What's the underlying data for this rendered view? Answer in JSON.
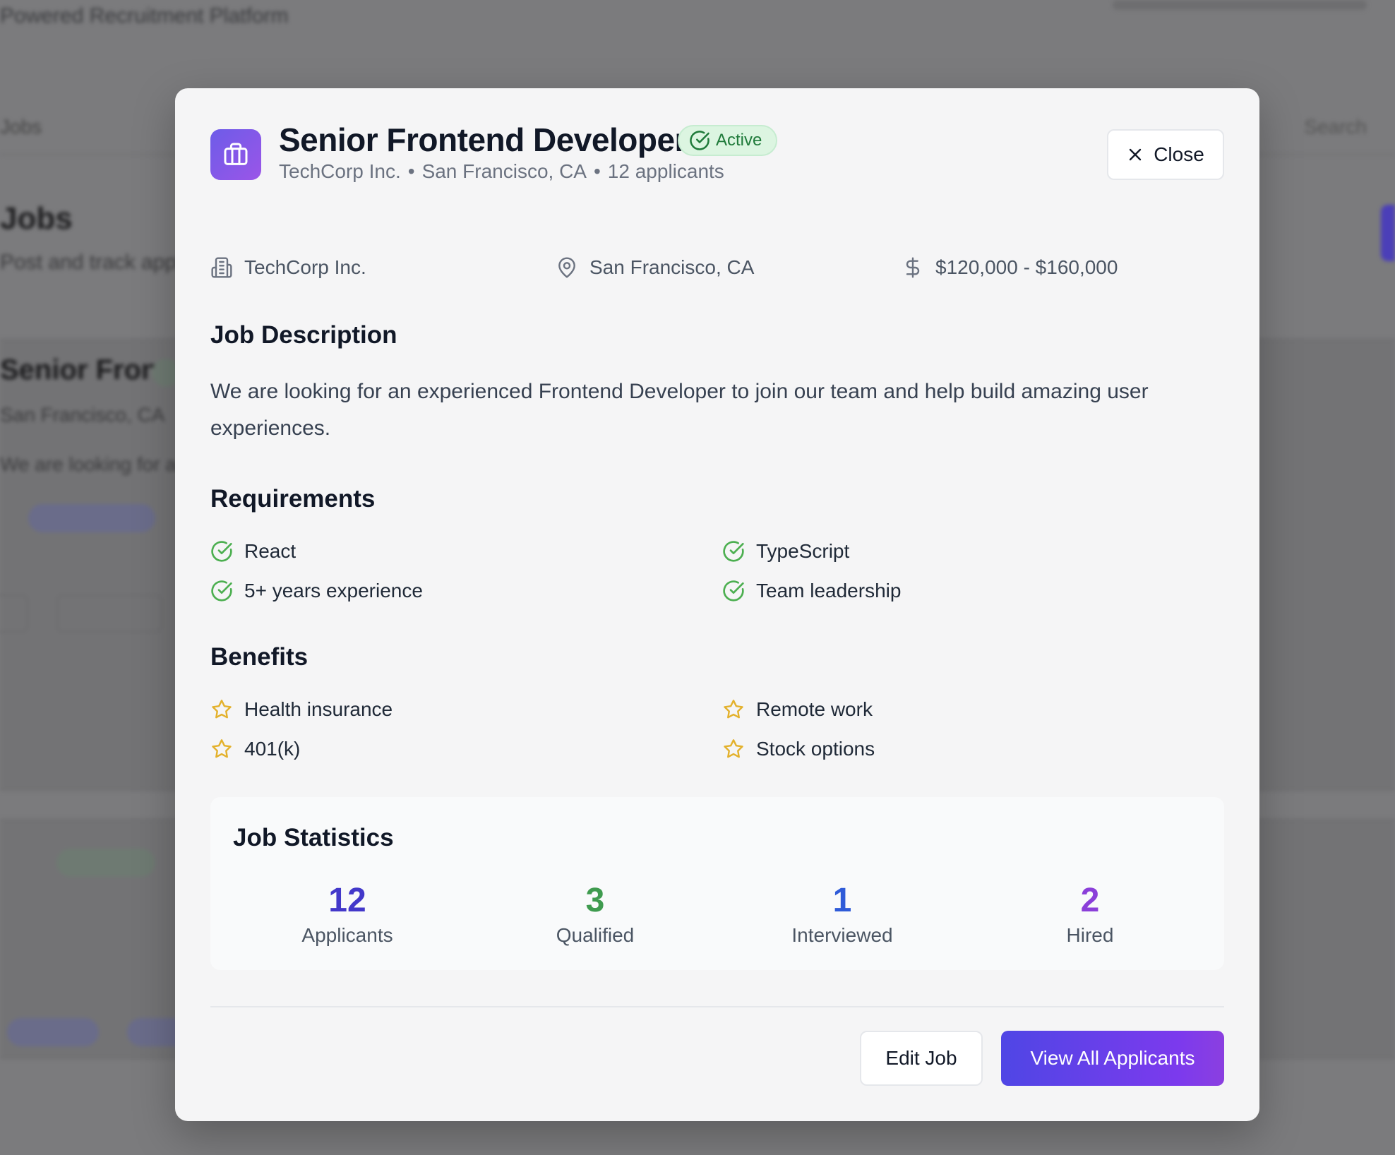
{
  "background": {
    "brand": "Powered Recruitment Platform",
    "nav_left": "Jobs",
    "nav_search": "Search",
    "page_heading": "Jobs",
    "page_sub": "Post and track applicants"
  },
  "modal": {
    "title": "Senior Frontend Developer",
    "status_badge": "Active",
    "subtitle": {
      "company": "TechCorp Inc.",
      "location": "San Francisco, CA",
      "applicants": "12 applicants"
    },
    "close_label": "Close",
    "meta": {
      "company": "TechCorp Inc.",
      "location": "San Francisco, CA",
      "salary": "$120,000 - $160,000"
    },
    "description_heading": "Job Description",
    "description": "We are looking for an experienced Frontend Developer to join our team and help build amazing user experiences.",
    "requirements_heading": "Requirements",
    "requirements": [
      "React",
      "TypeScript",
      "5+ years experience",
      "Team leadership"
    ],
    "benefits_heading": "Benefits",
    "benefits": [
      "Health insurance",
      "Remote work",
      "401(k)",
      "Stock options"
    ],
    "stats_heading": "Job Statistics",
    "stats": [
      {
        "value": "12",
        "label": "Applicants",
        "color": "#4338ca"
      },
      {
        "value": "3",
        "label": "Qualified",
        "color": "#3f9b4f"
      },
      {
        "value": "1",
        "label": "Interviewed",
        "color": "#2f5bd8"
      },
      {
        "value": "2",
        "label": "Hired",
        "color": "#8b3fd9"
      }
    ],
    "edit_label": "Edit Job",
    "view_label": "View All Applicants"
  },
  "colors": {
    "accent_gradient_start": "#4f46e5",
    "accent_gradient_end": "#7c3aed",
    "check_green": "#4caf50",
    "star_yellow": "#e3b12c"
  }
}
